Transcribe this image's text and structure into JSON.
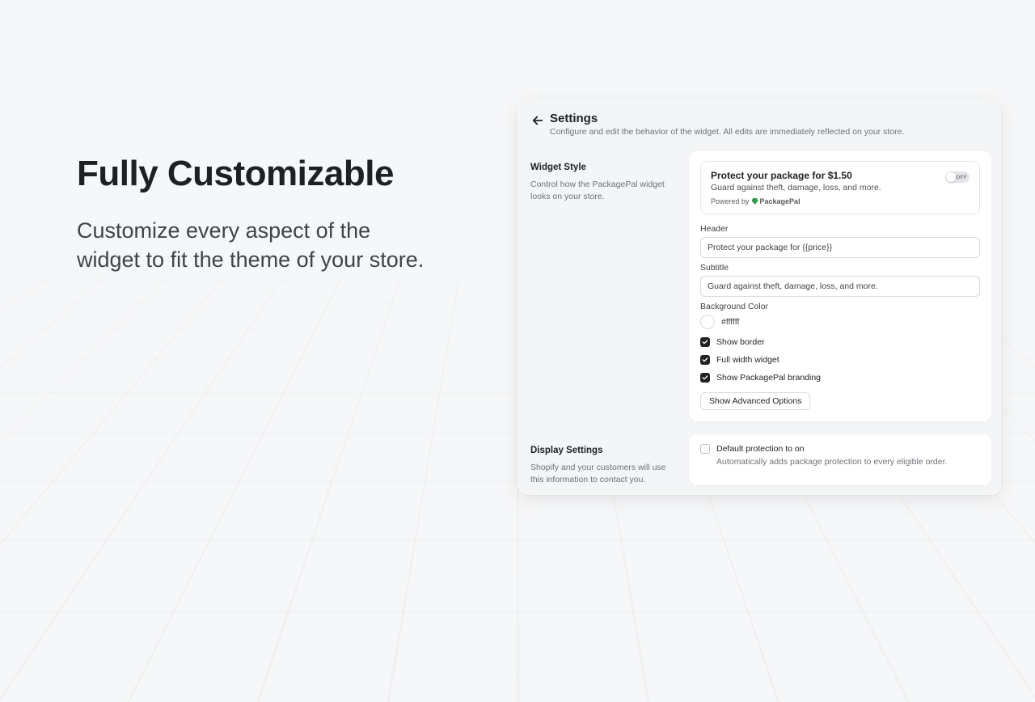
{
  "hero": {
    "title": "Fully Customizable",
    "body": "Customize every aspect of the widget to fit the theme of your store."
  },
  "panel": {
    "title": "Settings",
    "subtitle": "Configure and edit the behavior of the widget. All edits are immediately reflected on your store."
  },
  "widget_style": {
    "title": "Widget Style",
    "desc": "Control how the PackagePal widget looks on your store.",
    "preview": {
      "title": "Protect your package for $1.50",
      "subtitle": "Guard against theft, damage, loss, and more.",
      "powered_prefix": "Powered by",
      "brand_name": "PackagePal",
      "toggle_state": "OFF"
    },
    "fields": {
      "header_label": "Header",
      "header_value": "Protect your package for {{price}}",
      "subtitle_label": "Subtitle",
      "subtitle_value": "Guard against theft, damage, loss, and more.",
      "bg_label": "Background Color",
      "bg_value": "#ffffff"
    },
    "checks": {
      "show_border": "Show border",
      "full_width": "Full width widget",
      "show_branding": "Show PackagePal branding"
    },
    "advanced_btn": "Show Advanced Options"
  },
  "display_settings": {
    "title": "Display Settings",
    "desc": "Shopify and your customers will use this information to contact you.",
    "default_on_label": "Default protection to on",
    "default_on_desc": "Automatically adds package protection to every eligible order."
  }
}
